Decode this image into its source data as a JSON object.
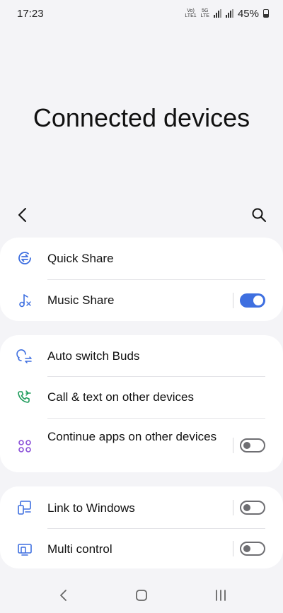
{
  "status_bar": {
    "time": "17:23",
    "volte_tag": "Vo)\nLTE1",
    "network_tag": "5G\nLTE",
    "battery_percent": "45%"
  },
  "header": {
    "title": "Connected devices"
  },
  "nav": {
    "back_icon": "chevron-left-icon",
    "search_icon": "search-icon"
  },
  "sections": [
    {
      "items": [
        {
          "label": "Quick Share",
          "icon": "quick-share-icon"
        },
        {
          "label": "Music Share",
          "icon": "music-share-icon",
          "toggle": true
        }
      ]
    },
    {
      "items": [
        {
          "label": "Auto switch Buds",
          "icon": "auto-switch-buds-icon"
        },
        {
          "label": "Call & text on other devices",
          "icon": "call-text-icon"
        },
        {
          "label": "Continue apps on other devices",
          "icon": "continue-apps-icon",
          "toggle": false
        }
      ]
    },
    {
      "items": [
        {
          "label": "Link to Windows",
          "icon": "link-to-windows-icon",
          "toggle": false
        },
        {
          "label": "Multi control",
          "icon": "multi-control-icon",
          "toggle": false
        }
      ]
    }
  ],
  "colors": {
    "accent": "#3e6fe0",
    "quick_share_icon": "#3e6fe0",
    "call_text_icon": "#1d9b5a",
    "continue_apps_icon": "#8a4fd8",
    "page_background": "#f4f4f7"
  }
}
